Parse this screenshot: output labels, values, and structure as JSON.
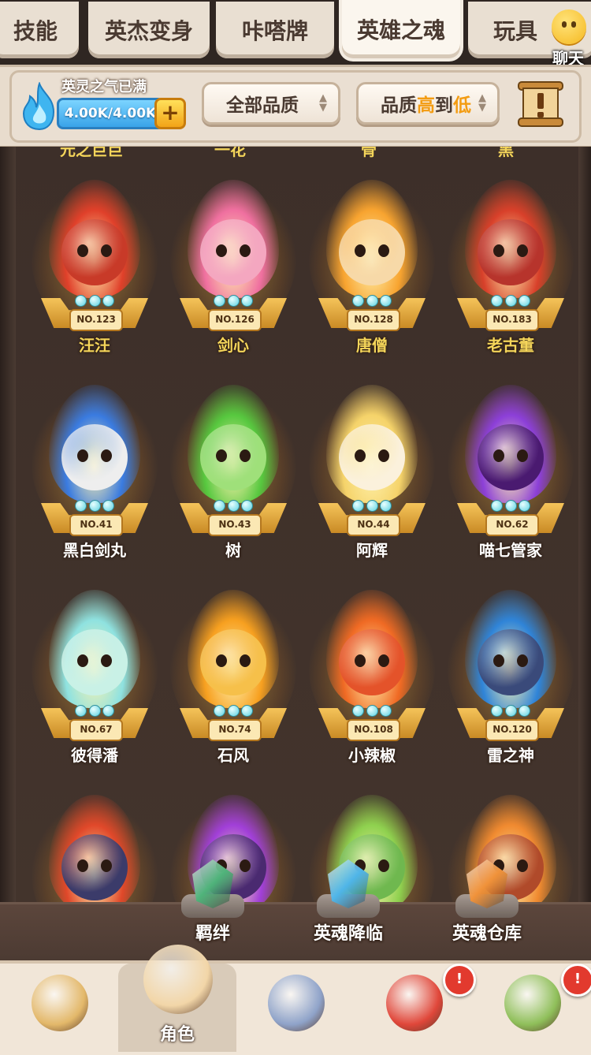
{
  "tabs": [
    {
      "label": "技能",
      "active": false
    },
    {
      "label": "英杰变身",
      "active": false
    },
    {
      "label": "咔嗒牌",
      "active": false
    },
    {
      "label": "英雄之魂",
      "active": true
    },
    {
      "label": "玩具",
      "active": false
    }
  ],
  "chat": {
    "label": "聊天",
    "icon": "chat-face-icon"
  },
  "spirit": {
    "title": "英灵之气已满",
    "value": "4.00K/4.00K",
    "add_icon": "plus-icon"
  },
  "filters": {
    "quality_label": "全部品质",
    "sort_label_part1": "品质",
    "sort_label_high": "高",
    "sort_label_mid": "到",
    "sort_label_low": "低"
  },
  "cut_off_names": [
    "元之巨巨",
    "一花",
    "骨",
    "黑"
  ],
  "heroes": [
    {
      "no": "NO.123",
      "name": "汪汪",
      "color": "#e0402a",
      "face": "#c83a28"
    },
    {
      "no": "NO.126",
      "name": "剑心",
      "color": "#f070a0",
      "face": "#f4a7c0"
    },
    {
      "no": "NO.128",
      "name": "唐僧",
      "color": "#f8a430",
      "face": "#f7d9a8"
    },
    {
      "no": "NO.183",
      "name": "老古董",
      "color": "#d8402a",
      "face": "#b7342c"
    },
    {
      "no": "NO.41",
      "name": "黑白剑丸",
      "color": "#3a7be0",
      "face": "#eeeeee"
    },
    {
      "no": "NO.43",
      "name": "树",
      "color": "#57c83f",
      "face": "#9fe07a"
    },
    {
      "no": "NO.44",
      "name": "阿辉",
      "color": "#f5d36a",
      "face": "#fbf1dc"
    },
    {
      "no": "NO.62",
      "name": "喵七管家",
      "color": "#8c3fd8",
      "face": "#4a1a70"
    },
    {
      "no": "NO.67",
      "name": "彼得潘",
      "color": "#8fe2e0",
      "face": "#c9f1e6"
    },
    {
      "no": "NO.74",
      "name": "石风",
      "color": "#f7a020",
      "face": "#f6c04a"
    },
    {
      "no": "NO.108",
      "name": "小辣椒",
      "color": "#f06a24",
      "face": "#e4532a"
    },
    {
      "no": "NO.120",
      "name": "雷之神",
      "color": "#2f84d8",
      "face": "#3a4a7a"
    },
    {
      "no": "",
      "name": "",
      "color": "#e0482a",
      "face": "#3b3b6a"
    },
    {
      "no": "",
      "name": "",
      "color": "#a13fd8",
      "face": "#4a2a70"
    },
    {
      "no": "",
      "name": "",
      "color": "#8fd14f",
      "face": "#6fb84f"
    },
    {
      "no": "",
      "name": "",
      "color": "#f08a30",
      "face": "#b04a2a"
    }
  ],
  "actions": [
    {
      "label": "羁绊",
      "icon": "green-gem-icon",
      "color": "#4fb37a"
    },
    {
      "label": "英魂降临",
      "icon": "blue-crystal-icon",
      "color": "#4fb5e8"
    },
    {
      "label": "英魂仓库",
      "icon": "orange-gem-icon",
      "color": "#f0923a"
    }
  ],
  "nav": [
    {
      "label": "",
      "icon": "caveman-icon",
      "active": false,
      "color": "#e3b86a"
    },
    {
      "label": "角色",
      "icon": "hero-avatar-icon",
      "active": true,
      "color": "#f2d6a8"
    },
    {
      "label": "",
      "icon": "sword-icon",
      "active": false,
      "color": "#8fa3c9"
    },
    {
      "label": "",
      "icon": "pet-icon",
      "active": false,
      "color": "#e0473a",
      "badge": "!"
    },
    {
      "label": "",
      "icon": "golem-icon",
      "active": false,
      "color": "#8fbf5a",
      "badge": "!"
    }
  ]
}
